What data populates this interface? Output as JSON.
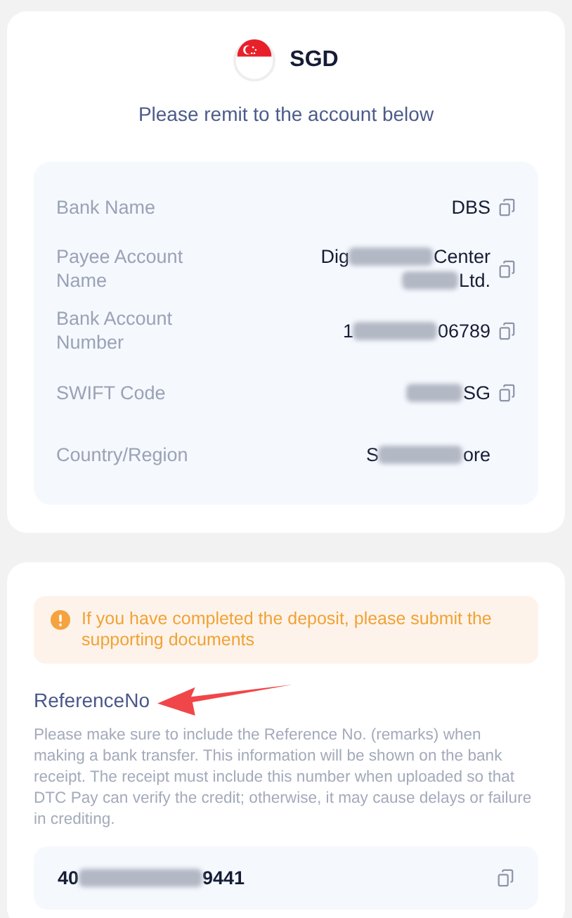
{
  "currency": {
    "code": "SGD",
    "subtitle": "Please remit to the account below"
  },
  "account_details": [
    {
      "label": "Bank Name",
      "copyable": true,
      "lines": [
        {
          "start": "DBS",
          "redacted": false
        }
      ]
    },
    {
      "label": "Payee Account Name",
      "copyable": true,
      "lines": [
        {
          "start": "Dig",
          "redacted": true,
          "end": "Center"
        },
        {
          "redacted": true,
          "end": "Ltd."
        }
      ]
    },
    {
      "label": "Bank Account Number",
      "copyable": true,
      "lines": [
        {
          "start": "1",
          "redacted": true,
          "end": "06789"
        }
      ]
    },
    {
      "label": "SWIFT Code",
      "copyable": true,
      "lines": [
        {
          "redacted": true,
          "end": "SG"
        }
      ]
    },
    {
      "label": "Country/Region",
      "copyable": false,
      "lines": [
        {
          "start": "S",
          "redacted": true,
          "end": "ore"
        }
      ]
    }
  ],
  "notice": {
    "message": "If you have completed the deposit, please submit the supporting documents"
  },
  "reference": {
    "label": "ReferenceNo",
    "description": "Please make sure to include the Reference No. (remarks) when making a bank transfer. This information will be shown on the bank receipt. The receipt must include this number when uploaded so that DTC Pay can verify the credit; otherwise, it may cause delays or failure in crediting.",
    "value_start": "40",
    "redacted": true,
    "value_end": "9441",
    "copyable": true
  },
  "annotations": [
    {
      "kind": "arrow"
    }
  ]
}
